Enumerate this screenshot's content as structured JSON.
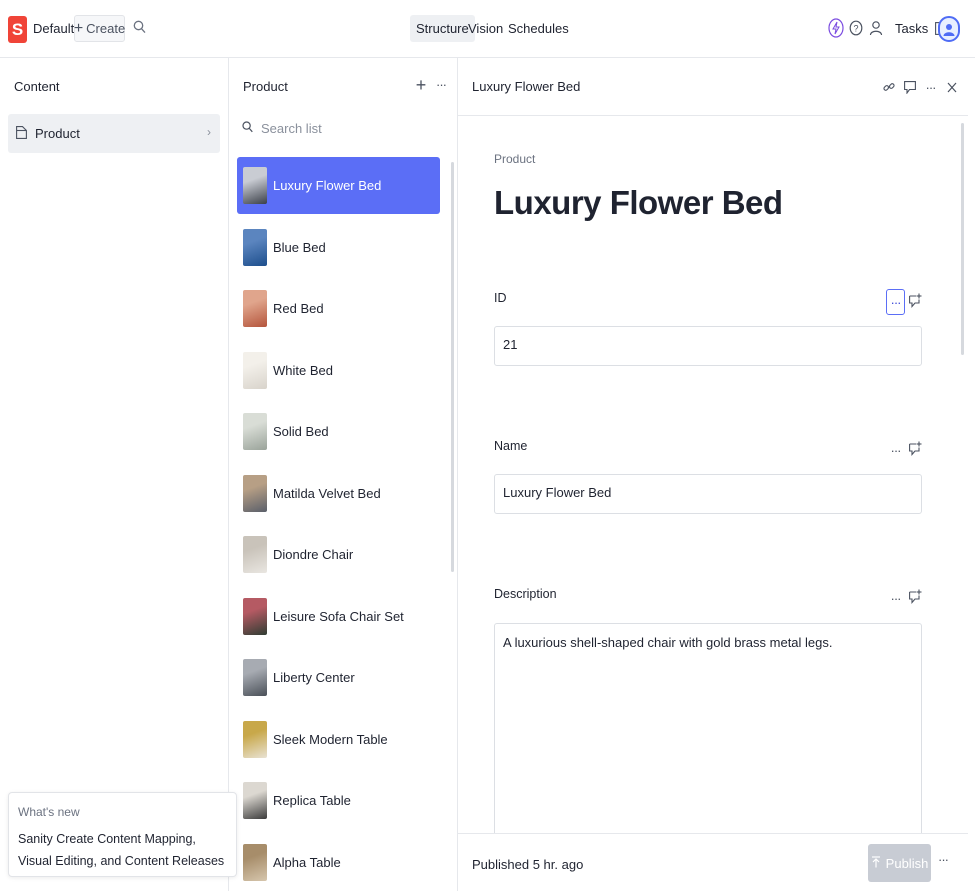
{
  "topbar": {
    "logo_letter": "S",
    "workspace": "Default",
    "create_label": "Create",
    "tabs": [
      "Structure",
      "Vision",
      "Schedules"
    ],
    "active_tab": "Structure",
    "tasks_label": "Tasks"
  },
  "content_pane": {
    "title": "Content",
    "items": [
      {
        "label": "Product"
      }
    ]
  },
  "whats_new": {
    "heading": "What's new",
    "body": "Sanity Create Content Mapping, Visual Editing, and Content Releases"
  },
  "product_pane": {
    "title": "Product",
    "search_placeholder": "Search list",
    "items": [
      {
        "label": "Luxury Flower Bed",
        "thumb_colors": [
          "#3a3f48",
          "#c9ccd3"
        ]
      },
      {
        "label": "Blue Bed",
        "thumb_colors": [
          "#1d4e8c",
          "#5b85bf"
        ]
      },
      {
        "label": "Red Bed",
        "thumb_colors": [
          "#b4553c",
          "#e0a58c"
        ]
      },
      {
        "label": "White Bed",
        "thumb_colors": [
          "#d8d3cb",
          "#f3f0ea"
        ]
      },
      {
        "label": "Solid Bed",
        "thumb_colors": [
          "#9aa39a",
          "#d9ddd6"
        ]
      },
      {
        "label": "Matilda Velvet Bed",
        "thumb_colors": [
          "#5a5f6a",
          "#b79f85"
        ]
      },
      {
        "label": "Diondre Chair",
        "thumb_colors": [
          "#e9e6e1",
          "#c9c3ba"
        ]
      },
      {
        "label": "Leisure Sofa Chair Set",
        "thumb_colors": [
          "#2f3d33",
          "#b55a63"
        ]
      },
      {
        "label": "Liberty Center",
        "thumb_colors": [
          "#4a5058",
          "#a7abb2"
        ]
      },
      {
        "label": "Sleek Modern Table",
        "thumb_colors": [
          "#e8e2d3",
          "#c8a84a"
        ]
      },
      {
        "label": "Replica Table",
        "thumb_colors": [
          "#3b3b3b",
          "#dcd8d1"
        ]
      },
      {
        "label": "Alpha Table",
        "thumb_colors": [
          "#d6c6ad",
          "#a78d6a"
        ]
      }
    ],
    "selected_index": 0
  },
  "document": {
    "header_title": "Luxury Flower Bed",
    "type_label": "Product",
    "title": "Luxury Flower Bed",
    "fields": {
      "id": {
        "label": "ID",
        "value": "21"
      },
      "name": {
        "label": "Name",
        "value": "Luxury Flower Bed"
      },
      "description": {
        "label": "Description",
        "value": "A luxurious shell-shaped chair with gold brass metal legs."
      }
    },
    "footer": {
      "status": "Published 5 hr. ago",
      "publish_label": "Publish"
    }
  },
  "colors": {
    "accent": "#5b6ef6",
    "logo": "#f04438",
    "publish_disabled": "#c8ccd4"
  }
}
